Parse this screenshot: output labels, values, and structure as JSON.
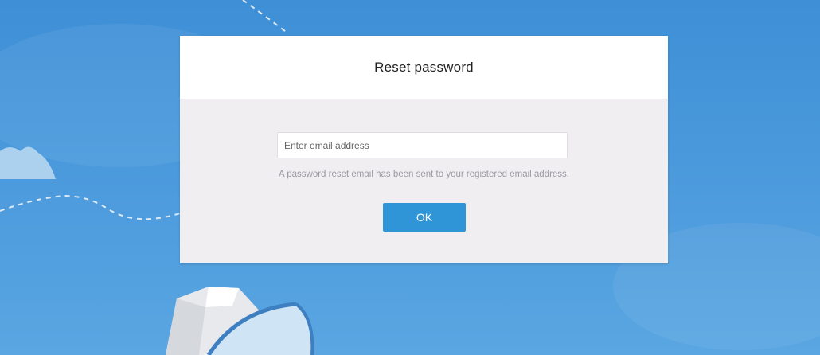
{
  "dialog": {
    "title": "Reset password"
  },
  "form": {
    "email_value": "",
    "email_placeholder": "Enter email address",
    "hint": "A password reset email has been sent to your registered email address.",
    "ok_label": "OK"
  },
  "colors": {
    "background": "#4a99dc",
    "dialog_body": "#f1eef2",
    "dialog_header": "#ffffff",
    "button": "#2f95d6"
  },
  "icons": {
    "background_art": [
      "cloud-icon",
      "dashed-flight-path",
      "paper-boat-icon"
    ]
  }
}
